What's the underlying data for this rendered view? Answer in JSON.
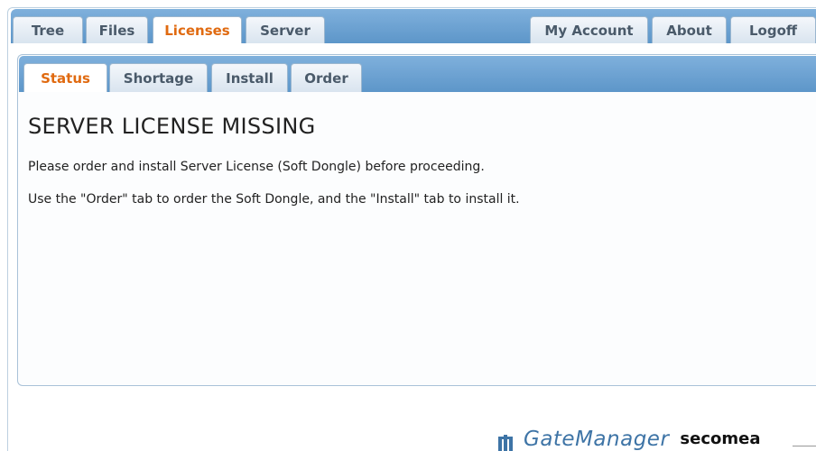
{
  "top_tabs": [
    {
      "label": "Tree"
    },
    {
      "label": "Files"
    },
    {
      "label": "Licenses"
    },
    {
      "label": "Server"
    }
  ],
  "right_tabs": [
    {
      "label": "My Account"
    },
    {
      "label": "About"
    },
    {
      "label": "Logoff"
    }
  ],
  "sub_tabs": [
    {
      "label": "Status"
    },
    {
      "label": "Shortage"
    },
    {
      "label": "Install"
    },
    {
      "label": "Order"
    }
  ],
  "active_top_tab": "Licenses",
  "active_sub_tab": "Status",
  "content": {
    "title": "SERVER LICENSE MISSING",
    "line1": "Please order and install Server License (Soft Dongle) before proceeding.",
    "line2": "Use the \"Order\" tab to order the Soft Dongle, and the \"Install\" tab to install it."
  },
  "footer": {
    "product": "GateManager",
    "brand": "secomea"
  },
  "colors": {
    "tab_bar": "#6ea3d3",
    "active_tab_text": "#e06a10",
    "brand_blue": "#3e74a6"
  }
}
